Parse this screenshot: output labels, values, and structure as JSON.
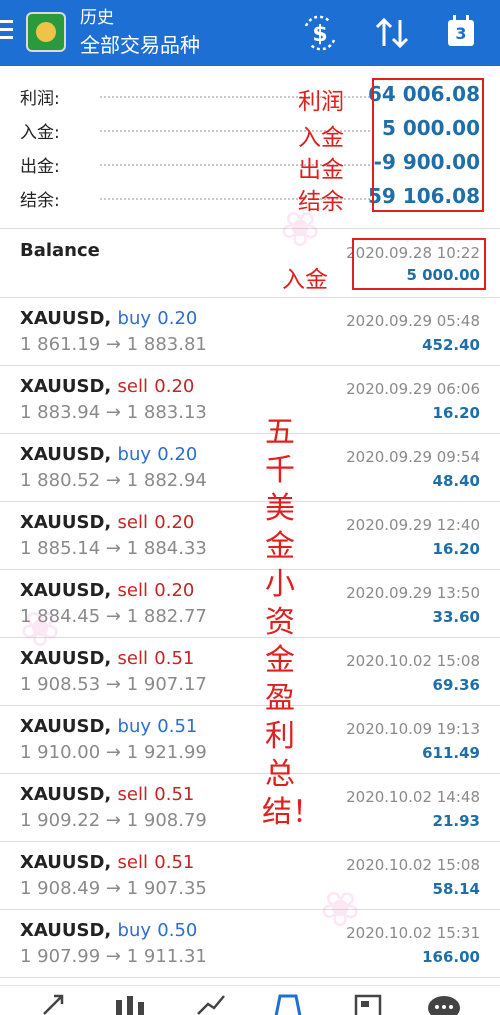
{
  "header": {
    "title": "历史",
    "subtitle": "全部交易品种",
    "calendar_badge": "3"
  },
  "summary": {
    "rows": [
      {
        "label": "利润:",
        "value": "64 006.08",
        "note": "利润"
      },
      {
        "label": "入金:",
        "value": "5 000.00",
        "note": "入金"
      },
      {
        "label": "出金:",
        "value": "-9 900.00",
        "note": "出金"
      },
      {
        "label": "结余:",
        "value": "59 106.08",
        "note": "结余"
      }
    ]
  },
  "balance": {
    "label": "Balance",
    "time": "2020.09.28 10:22",
    "amount": "5 000.00",
    "note": "入金"
  },
  "trades": [
    {
      "symbol": "XAUUSD",
      "type": "buy",
      "volume": "0.20",
      "open": "1 861.19",
      "close": "1 883.81",
      "time": "2020.09.29 05:48",
      "profit": "452.40"
    },
    {
      "symbol": "XAUUSD",
      "type": "sell",
      "volume": "0.20",
      "open": "1 883.94",
      "close": "1 883.13",
      "time": "2020.09.29 06:06",
      "profit": "16.20"
    },
    {
      "symbol": "XAUUSD",
      "type": "buy",
      "volume": "0.20",
      "open": "1 880.52",
      "close": "1 882.94",
      "time": "2020.09.29 09:54",
      "profit": "48.40"
    },
    {
      "symbol": "XAUUSD",
      "type": "sell",
      "volume": "0.20",
      "open": "1 885.14",
      "close": "1 884.33",
      "time": "2020.09.29 12:40",
      "profit": "16.20"
    },
    {
      "symbol": "XAUUSD",
      "type": "sell",
      "volume": "0.20",
      "open": "1 884.45",
      "close": "1 882.77",
      "time": "2020.09.29 13:50",
      "profit": "33.60"
    },
    {
      "symbol": "XAUUSD",
      "type": "sell",
      "volume": "0.51",
      "open": "1 908.53",
      "close": "1 907.17",
      "time": "2020.10.02 15:08",
      "profit": "69.36"
    },
    {
      "symbol": "XAUUSD",
      "type": "buy",
      "volume": "0.51",
      "open": "1 910.00",
      "close": "1 921.99",
      "time": "2020.10.09 19:13",
      "profit": "611.49"
    },
    {
      "symbol": "XAUUSD",
      "type": "sell",
      "volume": "0.51",
      "open": "1 909.22",
      "close": "1 908.79",
      "time": "2020.10.02 14:48",
      "profit": "21.93"
    },
    {
      "symbol": "XAUUSD",
      "type": "sell",
      "volume": "0.51",
      "open": "1 908.49",
      "close": "1 907.35",
      "time": "2020.10.02 15:08",
      "profit": "58.14"
    },
    {
      "symbol": "XAUUSD",
      "type": "buy",
      "volume": "0.50",
      "open": "1 907.99",
      "close": "1 911.31",
      "time": "2020.10.02 15:31",
      "profit": "166.00"
    }
  ],
  "annotation": "五千美金小资金盈利总结！",
  "colors": {
    "header_bg": "#1e6fd3",
    "value_blue": "#1f6ea8",
    "buy_blue": "#2b6fd0",
    "sell_red": "#c42525",
    "annotation_red": "#e0201e",
    "muted_gray": "#8a8a8a"
  },
  "bottom_nav": [
    "quotes-icon",
    "chart-icon",
    "trade-icon",
    "history-icon",
    "news-icon",
    "chat-icon"
  ]
}
